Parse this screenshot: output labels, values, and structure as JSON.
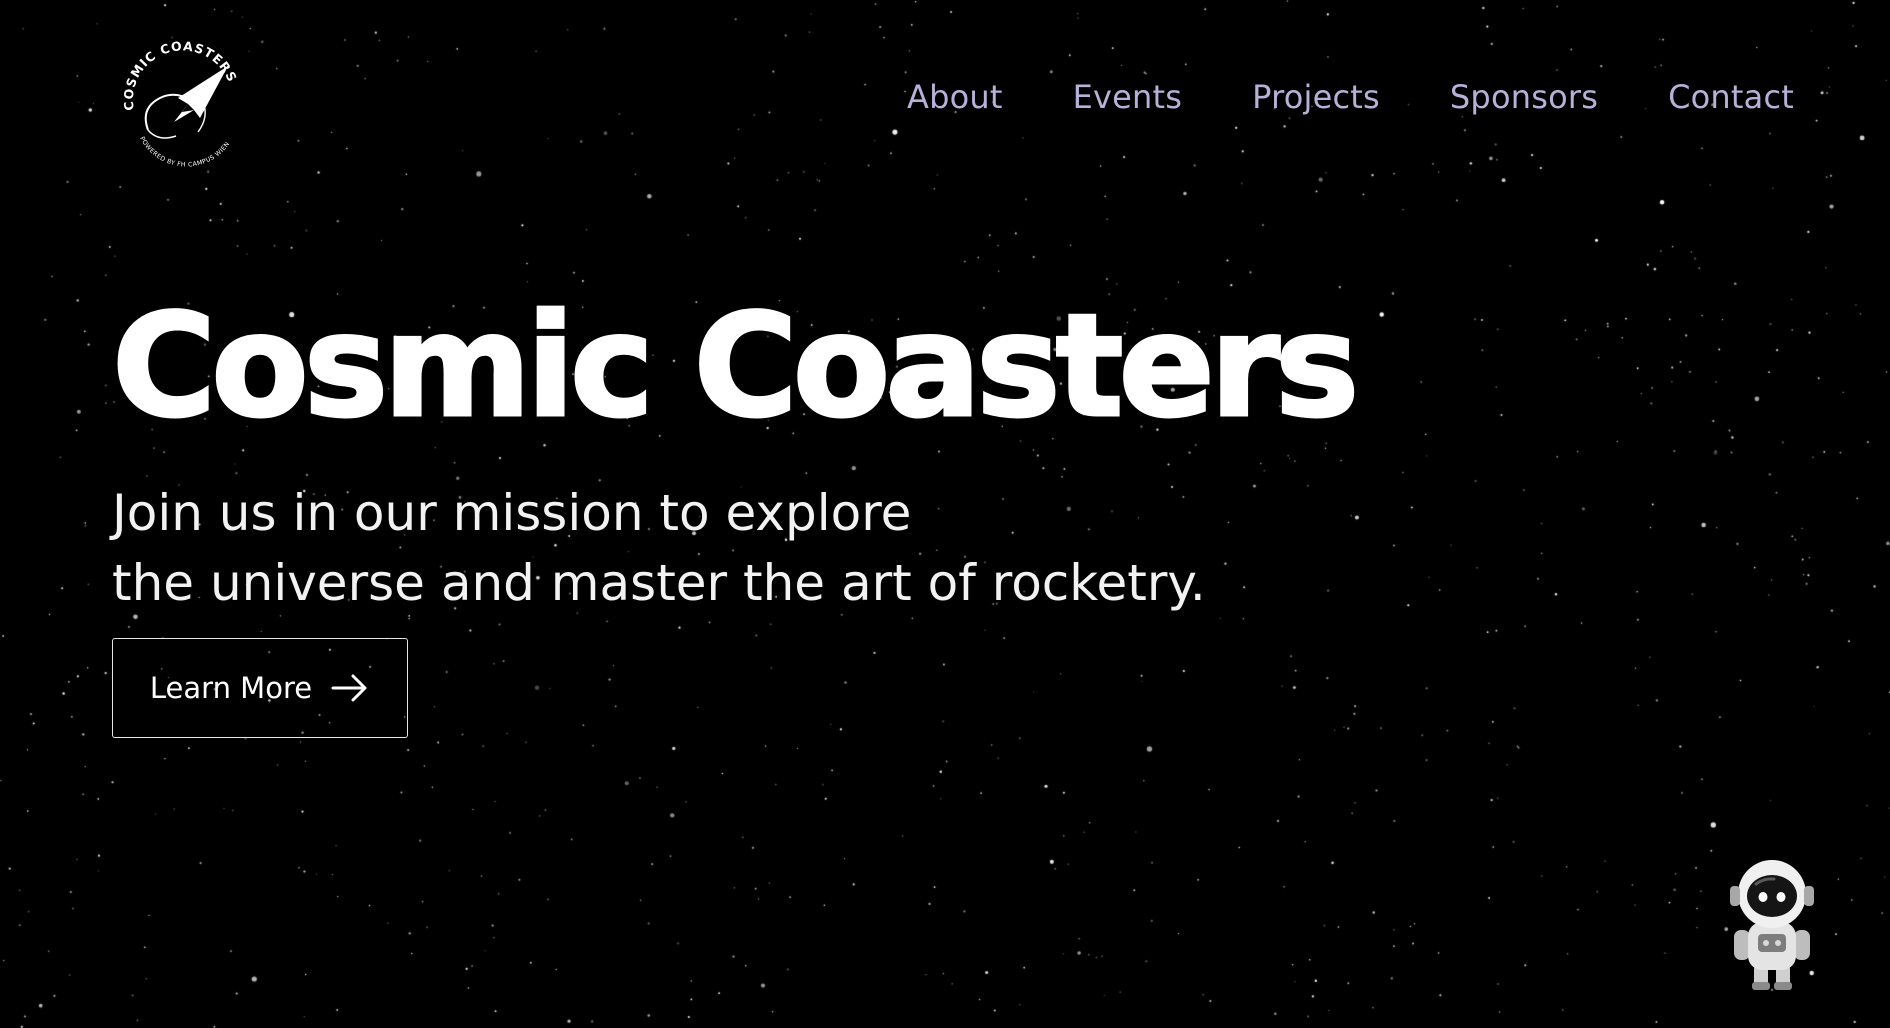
{
  "brand": {
    "logo_text_top": "COSMIC COASTERS",
    "logo_text_bottom": "POWERED BY FH CAMPUS WIEN",
    "icon": "rocket-logo-icon"
  },
  "nav": {
    "items": [
      {
        "label": "About"
      },
      {
        "label": "Events"
      },
      {
        "label": "Projects"
      },
      {
        "label": "Sponsors"
      },
      {
        "label": "Contact"
      }
    ]
  },
  "hero": {
    "title": "Cosmic Coasters",
    "subtitle_line1": "Join us in our mission to explore",
    "subtitle_line2": "the universe and master the art of rocketry."
  },
  "cta": {
    "label": "Learn More",
    "icon": "arrow-right-icon"
  },
  "mascot": {
    "icon": "astronaut-icon"
  },
  "colors": {
    "background": "#000000",
    "nav_text": "#b7b0d8",
    "title_text": "#ffffff",
    "button_border": "#e6e6e6"
  }
}
